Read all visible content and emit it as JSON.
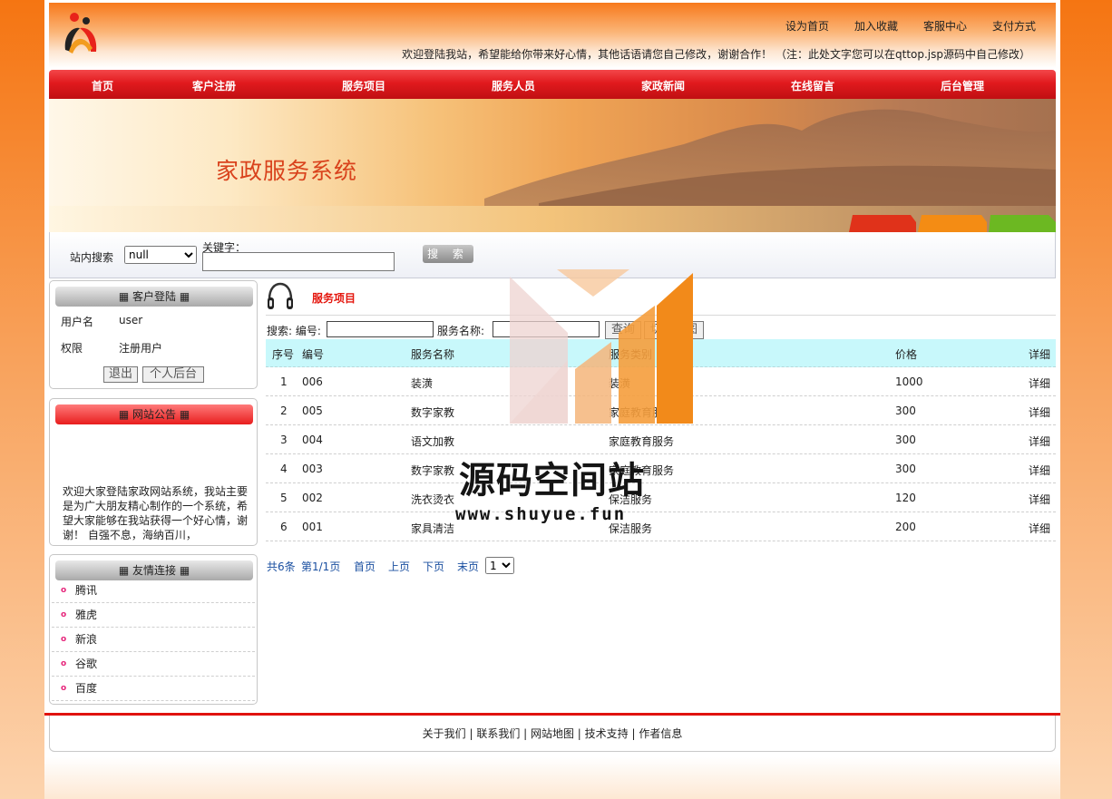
{
  "header": {
    "top_links": [
      "设为首页",
      "加入收藏",
      "客服中心",
      "支付方式"
    ],
    "welcome": "欢迎登陆我站，希望能给你带来好心情，其他话语请您自己修改，谢谢合作！ （注：此处文字您可以在qttop.jsp源码中自己修改）"
  },
  "nav": {
    "items": [
      "首页",
      "客户注册",
      "服务项目",
      "服务人员",
      "家政新闻",
      "在线留言",
      "后台管理"
    ]
  },
  "banner": {
    "title": "家政服务系统"
  },
  "site_search": {
    "label": "站内搜索",
    "select_value": "null",
    "keyword_label": "关键字：",
    "button": "搜 索"
  },
  "login_panel": {
    "title": "客户登陆",
    "username_label": "用户名",
    "username_value": "user",
    "role_label": "权限",
    "role_value": "注册用户",
    "logout_button": "退出",
    "backend_button": "个人后台"
  },
  "notice_panel": {
    "title": "网站公告",
    "text": "欢迎大家登陆家政网站系统，我站主要是为广大朋友精心制作的一个系统，希望大家能够在我站获得一个好心情，谢谢！ 自强不息，海纳百川，"
  },
  "links_panel": {
    "title": "友情连接",
    "items": [
      "腾讯",
      "雅虎",
      "新浪",
      "谷歌",
      "百度"
    ]
  },
  "main": {
    "title": "服务项目",
    "filter": {
      "code_label": "搜索: 编号:",
      "name_label": "服务名称:",
      "query_button": "查询",
      "switch_button": "切换视图"
    },
    "table": {
      "headers": [
        "序号",
        "编号",
        "服务名称",
        "服务类别",
        "价格",
        "详细"
      ],
      "rows": [
        [
          "1",
          "006",
          "装潢",
          "装潢",
          "1000",
          "详细"
        ],
        [
          "2",
          "005",
          "数字家教",
          "家庭教育服务",
          "300",
          "详细"
        ],
        [
          "3",
          "004",
          "语文加教",
          "家庭教育服务",
          "300",
          "详细"
        ],
        [
          "4",
          "003",
          "数字家教",
          "家庭教育服务",
          "300",
          "详细"
        ],
        [
          "5",
          "002",
          "洗衣烫衣",
          "保洁服务",
          "120",
          "详细"
        ],
        [
          "6",
          "001",
          "家具清洁",
          "保洁服务",
          "200",
          "详细"
        ]
      ]
    },
    "pager": {
      "total": "共6条",
      "page": "第1/1页",
      "first": "首页",
      "prev": "上页",
      "next": "下页",
      "last": "末页",
      "select_value": "1"
    }
  },
  "footer": {
    "text": "关于我们 | 联系我们 | 网站地图 | 技术支持 | 作者信息"
  },
  "watermark": {
    "text": "源码空间站",
    "url": "www.shuyue.fun"
  }
}
